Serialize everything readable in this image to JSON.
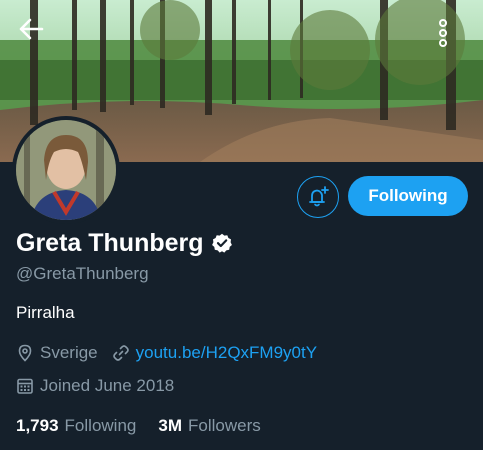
{
  "profile": {
    "name": "Greta Thunberg",
    "handle": "@GretaThunberg",
    "bio": "Pirralha",
    "location": "Sverige",
    "website": "youtu.be/H2QxFM9y0tY",
    "joined": "Joined June 2018",
    "verified": true
  },
  "stats": {
    "following_count": "1,793",
    "following_label": "Following",
    "followers_count": "3M",
    "followers_label": "Followers"
  },
  "actions": {
    "following_button_label": "Following"
  },
  "icons": {
    "back": "back-arrow-icon",
    "more": "more-vertical-icon",
    "notify": "notification-bell-plus-icon",
    "verified": "verified-badge-icon",
    "location": "location-pin-icon",
    "link": "link-icon",
    "calendar": "calendar-icon"
  },
  "colors": {
    "background": "#15202b",
    "accent": "#1da1f2",
    "text_primary": "#ffffff",
    "text_secondary": "#8899a6"
  }
}
